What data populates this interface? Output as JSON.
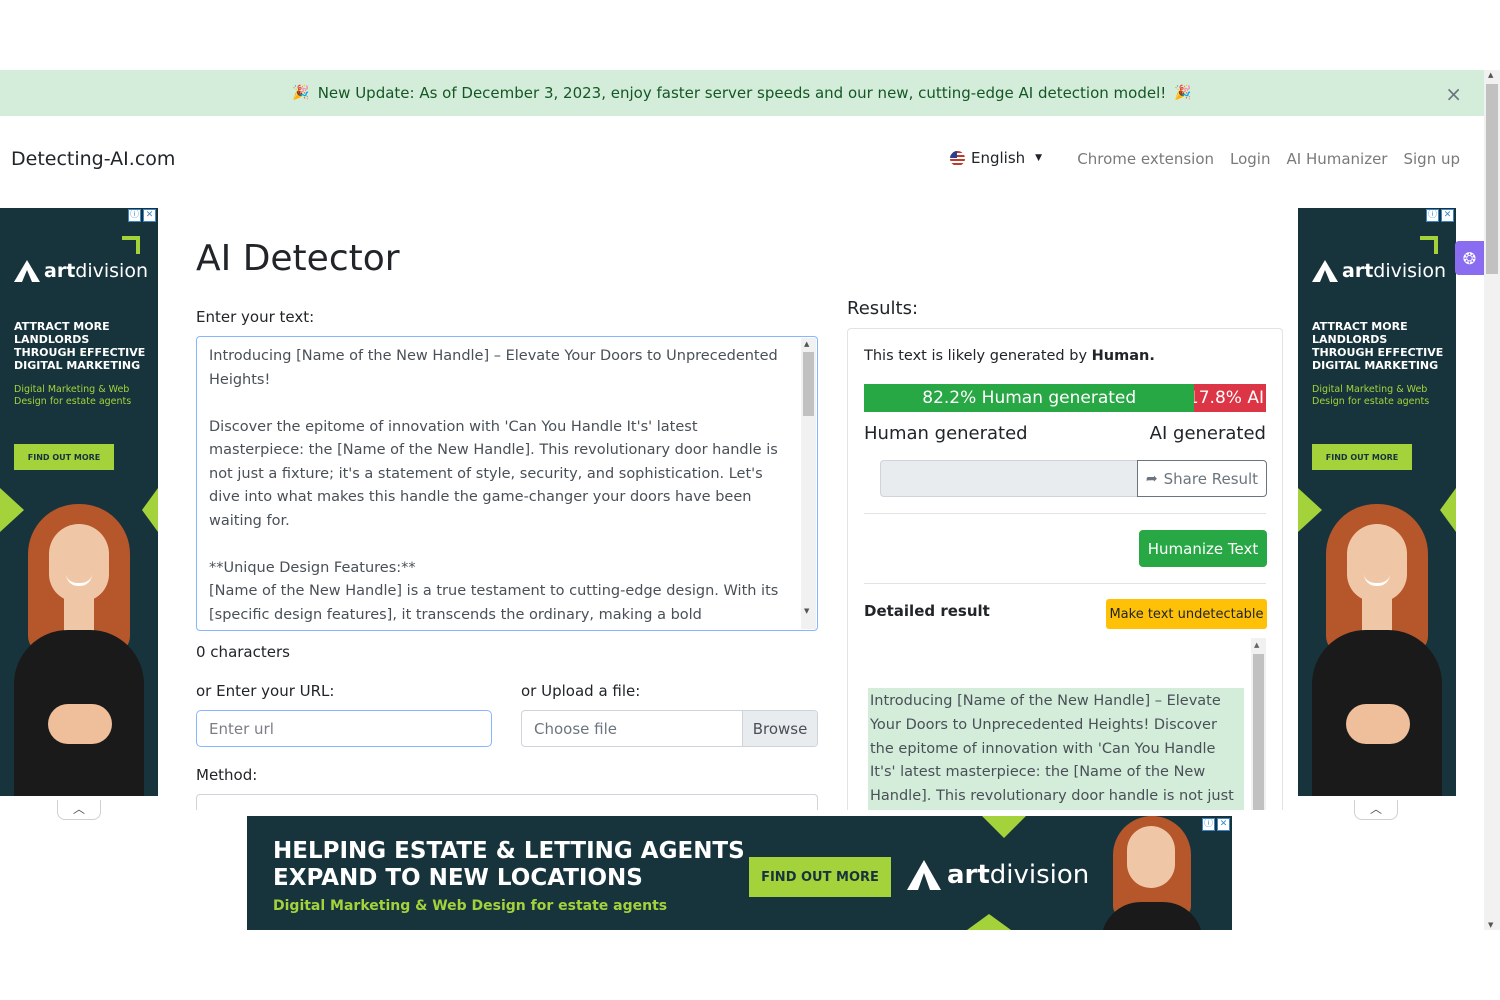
{
  "banner": {
    "message": "New Update: As of December 3, 2023, enjoy faster server speeds and our new, cutting-edge AI detection model!",
    "emoji_left": "🎉",
    "emoji_right": "🎉",
    "close": "×"
  },
  "navbar": {
    "brand": "Detecting-AI.com",
    "language": "English",
    "links": [
      "Chrome extension",
      "Login",
      "AI Humanizer",
      "Sign up"
    ]
  },
  "side_ad": {
    "brand_prefix": "art",
    "brand_suffix": "division",
    "headline": "ATTRACT MORE LANDLORDS THROUGH EFFECTIVE DIGITAL MARKETING",
    "subline": "Digital Marketing & Web Design for estate agents",
    "cta": "FIND OUT MORE",
    "info_icon": "ⓘ",
    "close_icon": "✕"
  },
  "main": {
    "title": "AI Detector",
    "text_label": "Enter your text:",
    "text_value": "Introducing [Name of the New Handle] – Elevate Your Doors to Unprecedented Heights!\n\nDiscover the epitome of innovation with 'Can You Handle It's' latest masterpiece: the [Name of the New Handle]. This revolutionary door handle is not just a fixture; it's a statement of style, security, and sophistication. Let's dive into what makes this handle the game-changer your doors have been waiting for.\n\n**Unique Design Features:**\n[Name of the New Handle] is a true testament to cutting-edge design. With its [specific design features], it transcends the ordinary, making a bold statement on any door. The sleek lines, thoughtful curves, and attention to detail showcase a",
    "char_count": "0 characters",
    "url_label": "or Enter your URL:",
    "url_placeholder": "Enter url",
    "file_label": "or Upload a file:",
    "file_placeholder": "Choose file",
    "browse": "Browse",
    "method_label": "Method:"
  },
  "results": {
    "title": "Results:",
    "likely_prefix": "This text is likely generated by ",
    "likely_value": "Human.",
    "human_pct": 82.2,
    "ai_pct": 17.8,
    "human_bar_label": "82.2% Human generated",
    "ai_bar_label": "17.8% AI",
    "human_label": "Human generated",
    "ai_label": "AI generated",
    "share": "Share Result",
    "humanize": "Humanize Text",
    "detailed": "Detailed result",
    "undetectable": "Make text undetectable",
    "detail_text": "Introducing [Name of the New Handle] – Elevate Your Doors to Unprecedented Heights! Discover the epitome of innovation with 'Can You Handle It's' latest masterpiece: the [Name of the New Handle]. This revolutionary door handle is not just a fixture; it's a"
  },
  "bottom_ad": {
    "headline_1": "HELPING ESTATE & LETTING AGENTS",
    "headline_2": "EXPAND TO NEW LOCATIONS",
    "subline": "Digital Marketing & Web Design for estate agents",
    "cta": "FIND OUT MORE",
    "brand_prefix": "art",
    "brand_suffix": "division"
  },
  "colors": {
    "human_green": "#28a745",
    "ai_red": "#dc3545",
    "warning_yellow": "#ffc107",
    "banner_green": "#d4edda",
    "ad_navy": "#17343d",
    "ad_lime": "#a4d23a"
  }
}
